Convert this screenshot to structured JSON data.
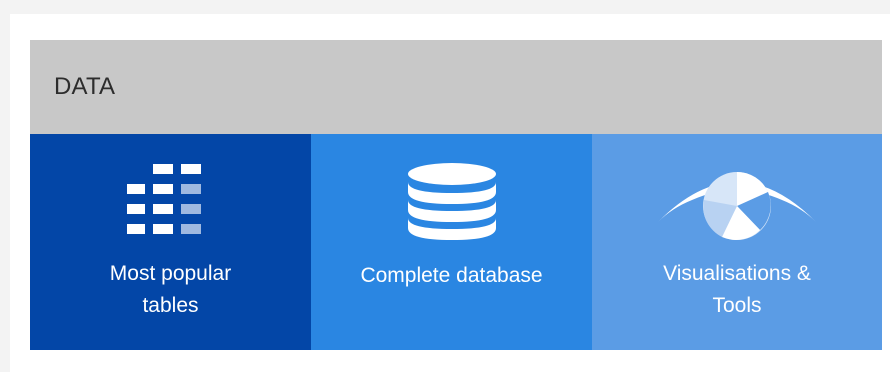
{
  "panel": {
    "title": "DATA"
  },
  "tiles": [
    {
      "label": "Most popular tables",
      "line1": "Most popular",
      "line2": "tables",
      "icon": "table-grid-icon",
      "color": "#0346a7"
    },
    {
      "label": "Complete database",
      "line1": "Complete database",
      "icon": "database-icon",
      "color": "#2a86e2"
    },
    {
      "label": "Visualisations & Tools",
      "line1": "Visualisations &",
      "line2": "Tools",
      "icon": "eye-icon",
      "color": "#5b9ce5"
    }
  ],
  "colors": {
    "page_background": "#f3f3f3",
    "card_background": "#ffffff",
    "header_background": "#c8c8c8",
    "header_text": "#2d2d2d",
    "tile_text": "#ffffff"
  }
}
